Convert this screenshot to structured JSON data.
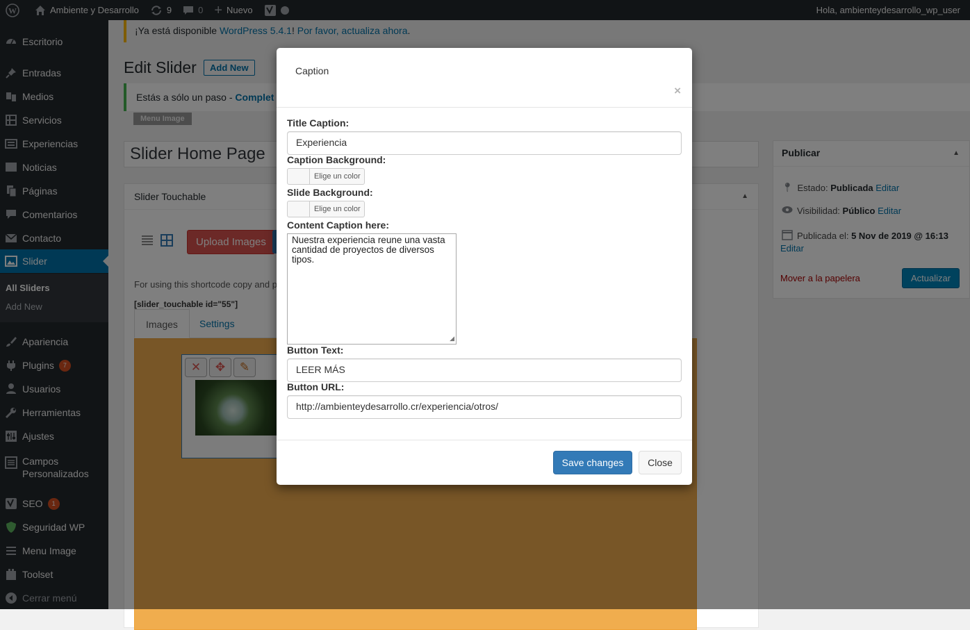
{
  "adminbar": {
    "site_name": "Ambiente y Desarrollo",
    "updates_count": "9",
    "comments_count": "0",
    "new_label": "Nuevo",
    "greeting": "Hola, ambienteydesarrollo_wp_user"
  },
  "sidebar": {
    "items": [
      {
        "label": "Escritorio",
        "icon": "dashboard-icon"
      },
      {
        "label": "Entradas",
        "icon": "pin-icon"
      },
      {
        "label": "Medios",
        "icon": "media-icon"
      },
      {
        "label": "Servicios",
        "icon": "services-icon"
      },
      {
        "label": "Experiencias",
        "icon": "experiences-icon"
      },
      {
        "label": "Noticias",
        "icon": "news-icon"
      },
      {
        "label": "Páginas",
        "icon": "pages-icon"
      },
      {
        "label": "Comentarios",
        "icon": "comments-icon"
      },
      {
        "label": "Contacto",
        "icon": "mail-icon"
      },
      {
        "label": "Slider",
        "icon": "slider-icon"
      },
      {
        "label": "Apariencia",
        "icon": "brush-icon"
      },
      {
        "label": "Plugins",
        "icon": "plugin-icon",
        "badge": "7"
      },
      {
        "label": "Usuarios",
        "icon": "users-icon"
      },
      {
        "label": "Herramientas",
        "icon": "wrench-icon"
      },
      {
        "label": "Ajustes",
        "icon": "settings-icon"
      },
      {
        "label": "Campos Personalizados",
        "icon": "fields-icon"
      },
      {
        "label": "SEO",
        "icon": "yoast-icon",
        "badge": "1"
      },
      {
        "label": "Seguridad WP",
        "icon": "shield-icon"
      },
      {
        "label": "Menu Image",
        "icon": "menu-icon"
      },
      {
        "label": "Toolset",
        "icon": "toolset-icon"
      },
      {
        "label": "Cerrar menú",
        "icon": "collapse-icon"
      }
    ],
    "submenu": [
      "All Sliders",
      "Add New"
    ]
  },
  "notice": {
    "prefix": "¡Ya está disponible ",
    "link1": "WordPress 5.4.1",
    "middle": "! ",
    "link2": "Por favor, actualiza ahora",
    "suffix": "."
  },
  "page": {
    "title": "Edit Slider",
    "add_new": "Add New",
    "notice2_text": "Estás a sólo un paso - ",
    "notice2_link": "Complet",
    "menu_image_btn": "Menu Image",
    "post_title": "Slider Home Page"
  },
  "metabox": {
    "title": "Slider Touchable",
    "upload_images": "Upload Images",
    "shortcode_text": "For using this shortcode copy and p",
    "shortcode": "[slider_touchable id=\"55\"]",
    "tab_images": "Images",
    "tab_settings": "Settings"
  },
  "publish": {
    "title": "Publicar",
    "estado_label": "Estado: ",
    "estado_value": "Publicada",
    "visibilidad_label": "Visibilidad: ",
    "visibilidad_value": "Público",
    "publicada_label": "Publicada el: ",
    "publicada_value": "5 Nov de 2019 @ 16:13",
    "edit": "Editar",
    "trash": "Mover a la papelera",
    "update": "Actualizar"
  },
  "modal": {
    "title": "Caption",
    "close_x": "×",
    "title_caption_label": "Title Caption:",
    "title_caption_value": "Experiencia",
    "caption_bg_label": "Caption Background:",
    "slide_bg_label": "Slide Background:",
    "color_button": "Elige un color",
    "content_label": "Content Caption here:",
    "content_value": "Nuestra experiencia reune una vasta cantidad de proyectos de diversos tipos.",
    "button_text_label": "Button Text:",
    "button_text_value": "LEER MÁS",
    "button_url_label": "Button URL:",
    "button_url_value": "http://ambienteydesarrollo.cr/experiencia/otros/",
    "save": "Save changes",
    "close": "Close"
  }
}
